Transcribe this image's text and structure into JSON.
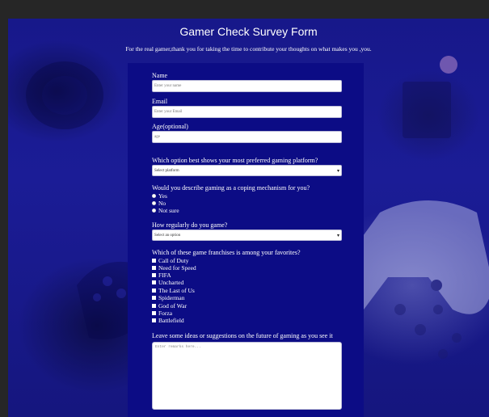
{
  "form": {
    "title": "Gamer Check Survey Form",
    "subtitle": "For the real gamer,thank you for taking the time to contribute your thoughts on what makes you ,you.",
    "name_label": "Name",
    "name_placeholder": "Enter your name",
    "email_label": "Email",
    "email_placeholder": "Enter your Email",
    "age_label": "Age(optional)",
    "age_placeholder": "age",
    "platform_question": "Which option best shows your most preferred gaming platform?",
    "platform_selected": "Select platform",
    "coping_question": "Would you describe gaming as a coping mechanism for you?",
    "coping_options": [
      "Yes",
      "No",
      "Not sure"
    ],
    "frequency_question": "How regularly do you game?",
    "frequency_selected": "Select an option",
    "franchise_question": "Which of these game franchises is among your favorites?",
    "franchises": [
      "Call of Duty",
      "Need for Speed",
      "FIFA",
      "Uncharted",
      "The Last of Us",
      "Spiderman",
      "God of War",
      "Forza",
      "Battlefield"
    ],
    "ideas_question": "Leave some ideas or suggestions on the future of gaming as you see it",
    "ideas_placeholder": "Enter remarks here..."
  },
  "icons": {
    "select_chevron": "chevron-down-icon"
  },
  "colors": {
    "page_bg": "#1b1c96",
    "panel_bg": "#0c0c85",
    "text": "#ffffff"
  }
}
